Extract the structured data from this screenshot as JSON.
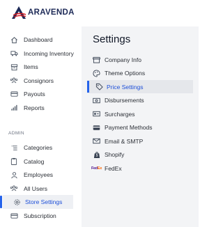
{
  "brand": {
    "name": "ARAVENDA",
    "colors": {
      "navy": "#1d2a57",
      "red": "#d71920"
    }
  },
  "sidebar": {
    "items": [
      {
        "label": "Dashboard",
        "icon": "home-icon"
      },
      {
        "label": "Incoming Inventory",
        "icon": "truck-icon"
      },
      {
        "label": "Items",
        "icon": "box-icon"
      },
      {
        "label": "Consignors",
        "icon": "users-icon"
      },
      {
        "label": "Payouts",
        "icon": "card-icon"
      },
      {
        "label": "Reports",
        "icon": "bar-chart-icon"
      }
    ],
    "admin_label": "ADMIN",
    "admin_items": [
      {
        "label": "Categories",
        "icon": "list-icon"
      },
      {
        "label": "Catalog",
        "icon": "clipboard-icon"
      },
      {
        "label": "Employees",
        "icon": "user-icon"
      },
      {
        "label": "All Users",
        "icon": "users-icon"
      },
      {
        "label": "Store Settings",
        "icon": "gear-icon",
        "active": true
      },
      {
        "label": "Subscription",
        "icon": "card-icon"
      }
    ]
  },
  "settings": {
    "title": "Settings",
    "items": [
      {
        "label": "Company Info",
        "icon": "store-icon"
      },
      {
        "label": "Theme Options",
        "icon": "palette-icon"
      },
      {
        "label": "Price Settings",
        "icon": "tag-icon",
        "active": true
      },
      {
        "label": "Disbursements",
        "icon": "cash-icon"
      },
      {
        "label": "Surcharges",
        "icon": "surcharge-icon"
      },
      {
        "label": "Payment Methods",
        "icon": "card-icon"
      },
      {
        "label": "Email & SMTP",
        "icon": "mail-icon"
      },
      {
        "label": "Shopify",
        "icon": "shopify-icon"
      },
      {
        "label": "FedEx",
        "icon": "fedex-icon"
      }
    ]
  },
  "accent_color": "#2563eb"
}
